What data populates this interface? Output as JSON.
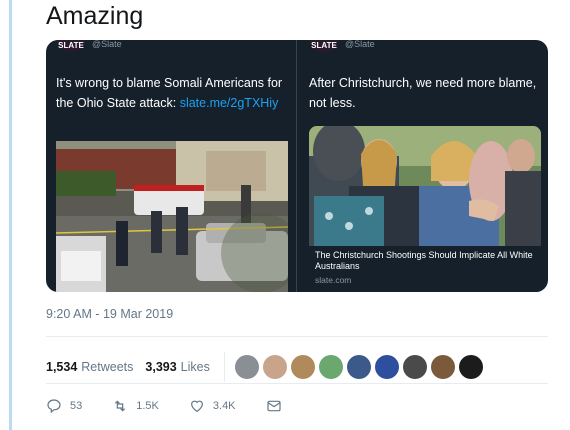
{
  "tweet": {
    "text": "Amazing"
  },
  "quoted_left": {
    "logo": "SLATE",
    "handle": "@Slate",
    "text": "It's wrong to blame Somali Americans for the Ohio State attack: ",
    "link": "slate.me/2gTXHiy"
  },
  "quoted_right": {
    "logo": "SLATE",
    "handle": "@Slate",
    "text": "After Christchurch, we need more blame, not less.",
    "card_title": "The Christchurch Shootings Should Implicate All White Australians",
    "card_domain": "slate.com"
  },
  "meta": {
    "timestamp": "9:20 AM - 19 Mar 2019"
  },
  "stats": {
    "retweets_count": "1,534",
    "retweets_label": "Retweets",
    "likes_count": "3,393",
    "likes_label": "Likes"
  },
  "liker_avatars": [
    "#8a8f96",
    "#c8a58a",
    "#b08a5a",
    "#6aa870",
    "#3b5a8a",
    "#2d4f9e",
    "#4a4a4a",
    "#7a5a3a",
    "#1c1c1c"
  ],
  "actions": {
    "replies": "53",
    "retweets": "1.5K",
    "likes": "3.4K"
  },
  "colors": {
    "accent": "#1da1f2",
    "card_bg": "#15202b"
  }
}
